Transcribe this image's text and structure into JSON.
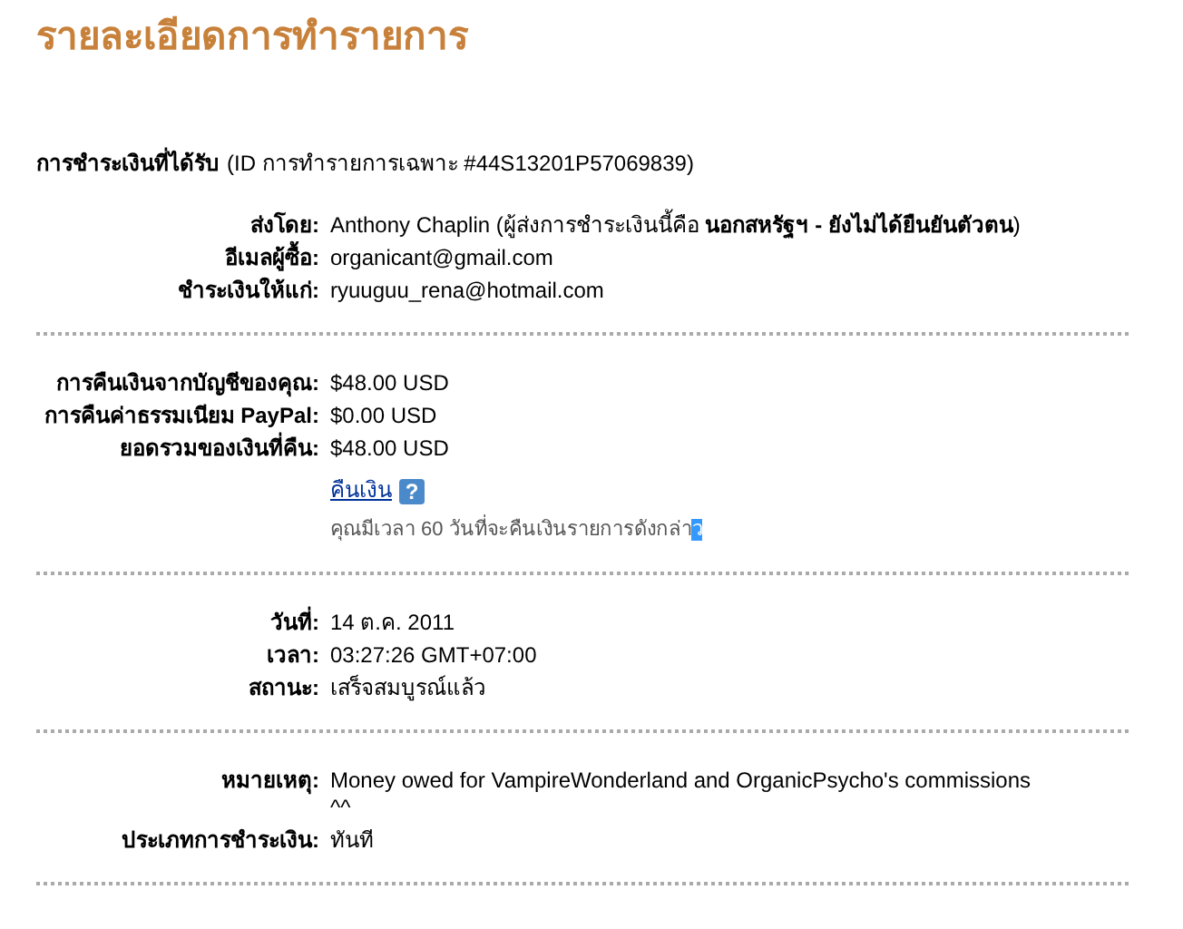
{
  "title": "รายละเอียดการทำรายการ",
  "payment_heading": {
    "label": "การชำระเงินที่ได้รับ",
    "id_text": "(ID การทำรายการเฉพาะ #44S13201P57069839)"
  },
  "sections": [
    {
      "rows": [
        {
          "label": "ส่งโดย:",
          "value": "Anthony Chaplin (ผู้ส่งการชำระเงินนี้คือ **นอกสหรัฐฯ - ยังไม่ได้ยืนยันตัวตน**)"
        },
        {
          "label": "อีเมลผู้ซื้อ:",
          "value": "organicant@gmail.com"
        },
        {
          "label": "ชำระเงินให้แก่:",
          "value": "ryuuguu_rena@hotmail.com"
        }
      ]
    },
    {
      "rows": [
        {
          "label": "การคืนเงินจากบัญชีของคุณ:",
          "value": "$48.00 USD"
        },
        {
          "label": "การคืนค่าธรรมเนียม PayPal:",
          "value": "$0.00 USD"
        },
        {
          "label": "ยอดรวมของเงินที่คืน:",
          "value": "$48.00 USD"
        }
      ],
      "refund_link": "คืนเงิน",
      "help": "?",
      "note": "คุณมีเวลา 60 วันที่จะคืนเงินรายการดังกล่า",
      "note_selected": "ว"
    },
    {
      "rows": [
        {
          "label": "วันที่:",
          "value": "14 ต.ค. 2011"
        },
        {
          "label": "เวลา:",
          "value": "03:27:26 GMT+07:00"
        },
        {
          "label": "สถานะ:",
          "value": "เสร็จสมบูรณ์แล้ว"
        }
      ]
    },
    {
      "rows": [
        {
          "label": "หมายเหตุ:",
          "value": "Money owed for VampireWonderland and OrganicPsycho's commissions ^^"
        },
        {
          "label": "ประเภทการชำระเงิน:",
          "value": "ทันที"
        }
      ]
    }
  ]
}
